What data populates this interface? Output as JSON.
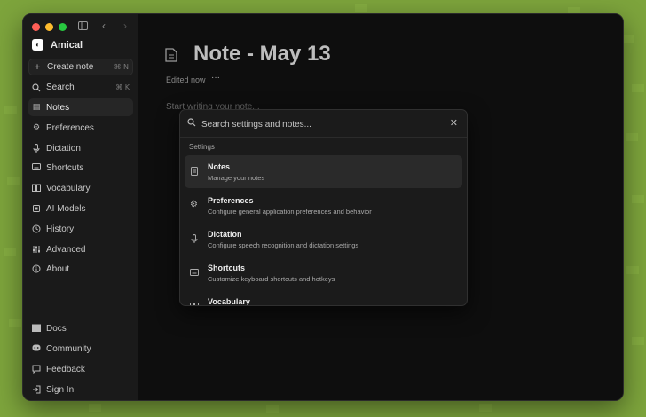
{
  "app": {
    "name": "Amical"
  },
  "sidebar": {
    "create_note": {
      "label": "Create note",
      "shortcut": "⌘ N"
    },
    "search": {
      "label": "Search",
      "shortcut": "⌘ K"
    },
    "items": [
      {
        "label": "Notes",
        "icon": "note-icon"
      },
      {
        "label": "Preferences",
        "icon": "gear-icon"
      },
      {
        "label": "Dictation",
        "icon": "mic-icon"
      },
      {
        "label": "Shortcuts",
        "icon": "keyboard-icon"
      },
      {
        "label": "Vocabulary",
        "icon": "book-icon"
      },
      {
        "label": "AI Models",
        "icon": "ai-icon"
      },
      {
        "label": "History",
        "icon": "history-icon"
      },
      {
        "label": "Advanced",
        "icon": "sliders-icon"
      },
      {
        "label": "About",
        "icon": "info-icon"
      }
    ],
    "footer": [
      {
        "label": "Docs",
        "icon": "docs-icon"
      },
      {
        "label": "Community",
        "icon": "discord-icon"
      },
      {
        "label": "Feedback",
        "icon": "feedback-icon"
      },
      {
        "label": "Sign In",
        "icon": "signin-icon"
      }
    ]
  },
  "note": {
    "title": "Note - May 13",
    "edited": "Edited now",
    "more": "···",
    "placeholder": "Start writing your note..."
  },
  "palette": {
    "search_placeholder": "Search settings and notes...",
    "section": "Settings",
    "results": [
      {
        "title": "Notes",
        "desc": "Manage your notes"
      },
      {
        "title": "Preferences",
        "desc": "Configure general application preferences and behavior"
      },
      {
        "title": "Dictation",
        "desc": "Configure speech recognition and dictation settings"
      },
      {
        "title": "Shortcuts",
        "desc": "Customize keyboard shortcuts and hotkeys"
      },
      {
        "title": "Vocabulary",
        "desc": ""
      }
    ]
  },
  "colors": {
    "background": "#7da43c",
    "window": "#0e0e0e",
    "sidebar": "#1a1a1a"
  }
}
